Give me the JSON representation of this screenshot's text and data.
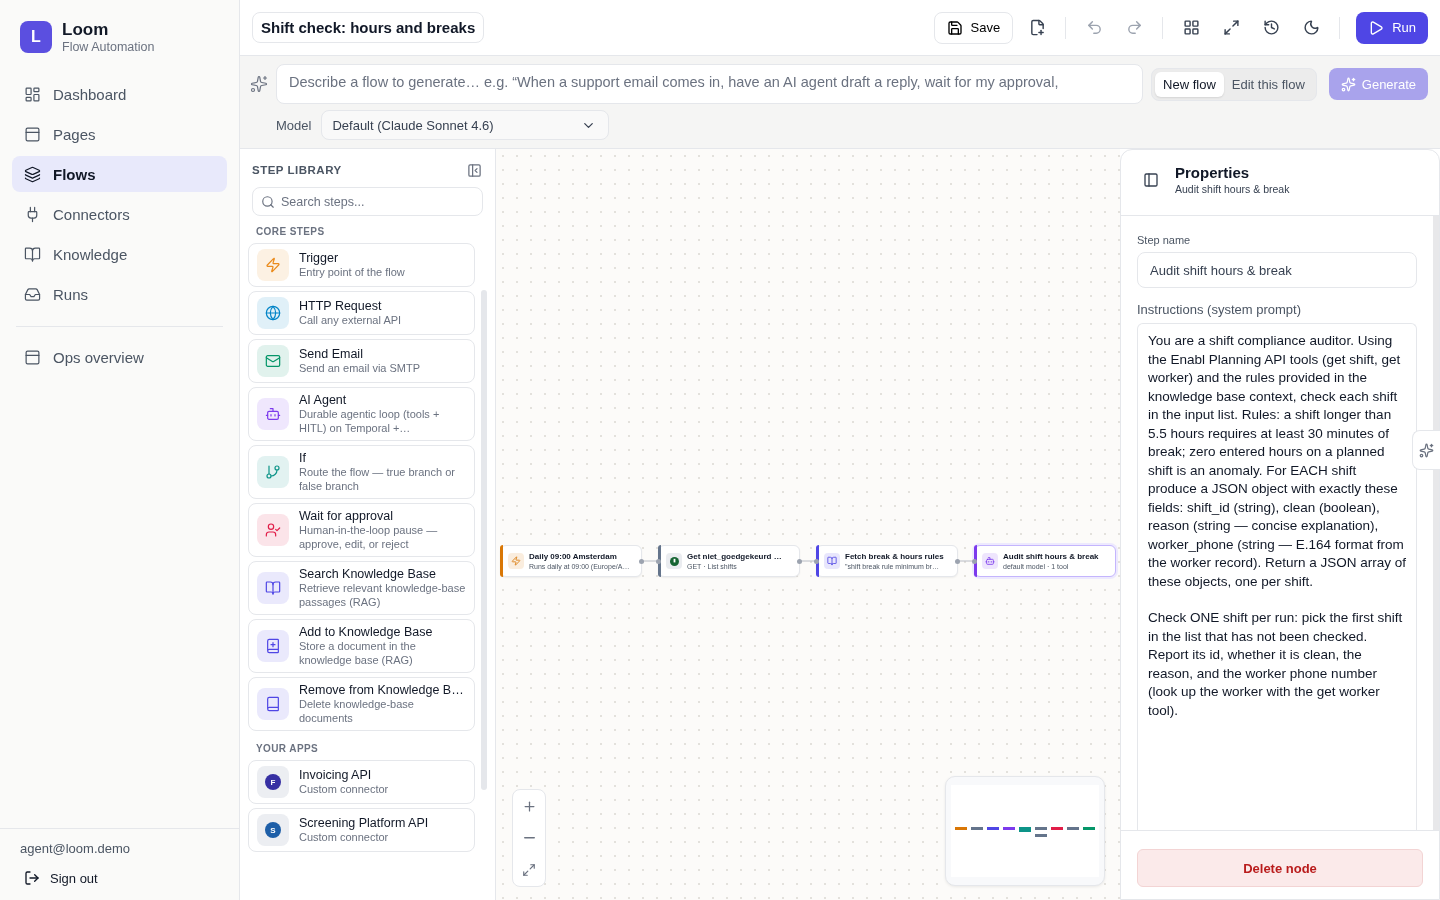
{
  "brand": {
    "logo": "L",
    "name": "Loom",
    "tagline": "Flow Automation"
  },
  "nav": [
    {
      "label": "Dashboard",
      "selected": false
    },
    {
      "label": "Pages",
      "selected": false
    },
    {
      "label": "Flows",
      "selected": true
    },
    {
      "label": "Connectors",
      "selected": false
    },
    {
      "label": "Knowledge",
      "selected": false
    },
    {
      "label": "Runs",
      "selected": false
    }
  ],
  "nav_extra": [
    {
      "label": "Ops overview",
      "selected": false
    }
  ],
  "account": {
    "email": "agent@loom.demo",
    "sign_out": "Sign out"
  },
  "flow_title": "Shift check: hours and breaks",
  "toolbar": {
    "save": "Save",
    "run": "Run"
  },
  "generator": {
    "placeholder": "Describe a flow to generate… e.g. “When a support email comes in, have an AI agent draft a reply, wait for my approval,",
    "modes": [
      {
        "label": "New flow",
        "selected": true
      },
      {
        "label": "Edit this flow",
        "selected": false
      }
    ],
    "generate": "Generate",
    "generate_disabled": true,
    "model_label": "Model",
    "model_value": "Default (Claude Sonnet 4.6)"
  },
  "library": {
    "title": "STEP LIBRARY",
    "search_placeholder": "Search steps...",
    "sections": [
      {
        "title": "CORE STEPS",
        "items": [
          {
            "name": "Trigger",
            "desc": "Entry point of the flow"
          },
          {
            "name": "HTTP Request",
            "desc": "Call any external API"
          },
          {
            "name": "Send Email",
            "desc": "Send an email via SMTP"
          },
          {
            "name": "AI Agent",
            "desc": "Durable agentic loop (tools + HITL) on Temporal +…"
          },
          {
            "name": "If",
            "desc": "Route the flow — true branch or false branch"
          },
          {
            "name": "Wait for approval",
            "desc": "Human-in-the-loop pause — approve, edit, or reject"
          },
          {
            "name": "Search Knowledge Base",
            "desc": "Retrieve relevant knowledge-base passages (RAG)"
          },
          {
            "name": "Add to Knowledge Base",
            "desc": "Store a document in the knowledge base (RAG)"
          },
          {
            "name": "Remove from Knowledge B…",
            "desc": "Delete knowledge-base documents"
          }
        ]
      },
      {
        "title": "YOUR APPS",
        "items": [
          {
            "name": "Invoicing API",
            "desc": "Custom connector",
            "letter": "F",
            "color": "#3730a3"
          },
          {
            "name": "Screening Platform API",
            "desc": "Custom connector",
            "letter": "S",
            "color": "#1e5fa8"
          }
        ]
      }
    ]
  },
  "canvas": {
    "nodes": [
      {
        "title": "Daily 09:00 Amsterdam",
        "subtitle": "Runs daily at 09:00 (Europe/A…",
        "color": "#d97706",
        "selected": false
      },
      {
        "title": "Get niet_goedgekeurd …",
        "subtitle": "GET · List shifts",
        "color": "#64748b",
        "selected": false
      },
      {
        "title": "Fetch break & hours rules",
        "subtitle": "\"shift break rule minimum br…",
        "color": "#4f46e5",
        "selected": false
      },
      {
        "title": "Audit shift hours & break",
        "subtitle": "default model · 1 tool",
        "color": "#7c3aed",
        "selected": true
      }
    ]
  },
  "properties": {
    "title": "Properties",
    "subtitle": "Audit shift hours & break",
    "step_name_label": "Step name",
    "step_name": "Audit shift hours & break",
    "instructions_label": "Instructions (system prompt)",
    "instructions": [
      "You are a shift compliance auditor. Using the Enabl Planning API tools (get shift, get worker) and the rules provided in the knowledge base context, check each shift in the input list. Rules: a shift longer than 5.5 hours requires at least 30 minutes of break; zero entered hours on a planned shift is an anomaly. For EACH shift produce a JSON object with exactly these fields: shift_id (string), clean (boolean), reason (string — concise explanation), worker_phone (string — E.164 format from the worker record). Return a JSON array of these objects, one per shift.",
      "Check ONE shift per run: pick the first shift in the list that has not been checked. Report its id, whether it is clean, the reason, and the worker phone number (look up the worker with the get worker tool)."
    ],
    "delete": "Delete node"
  }
}
